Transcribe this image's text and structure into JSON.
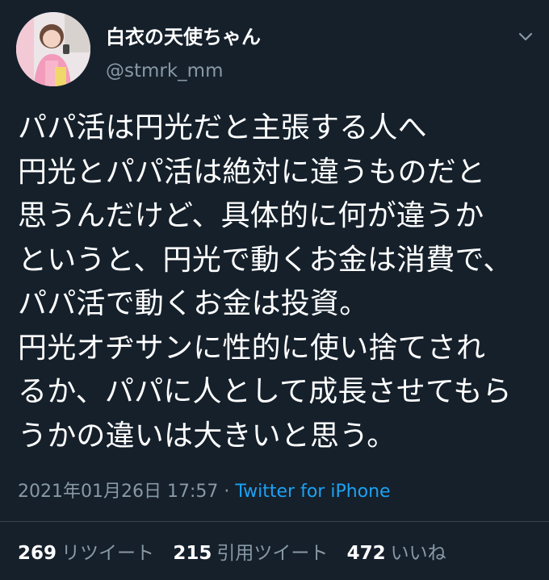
{
  "author": {
    "display_name": "白衣の天使ちゃん",
    "handle": "@stmrk_mm",
    "avatar_icon": "avatar-photo"
  },
  "menu": {
    "caret_icon": "chevron-down-icon"
  },
  "tweet": {
    "text": "パパ活は円光だと主張する人へ\n円光とパパ活は絶対に違うものだと\n思うんだけど、具体的に何が違うか\nというと、円光で動くお金は消費で、\nパパ活で動くお金は投資。\n円光オヂサンに性的に使い捨てされ\nるか、パパに人として成長させてもら\nうかの違いは大きいと思う。",
    "timestamp": "2021年01月26日 17:57",
    "separator": " · ",
    "source": "Twitter for iPhone"
  },
  "stats": {
    "retweets": {
      "count": "269",
      "label": "リツイート"
    },
    "quotes": {
      "count": "215",
      "label": "引用ツイート"
    },
    "likes": {
      "count": "472",
      "label": "いいね"
    }
  },
  "colors": {
    "background": "#15202b",
    "text": "#ffffff",
    "secondary": "#8899a6",
    "link": "#1da1f2",
    "divider": "#38444d"
  }
}
